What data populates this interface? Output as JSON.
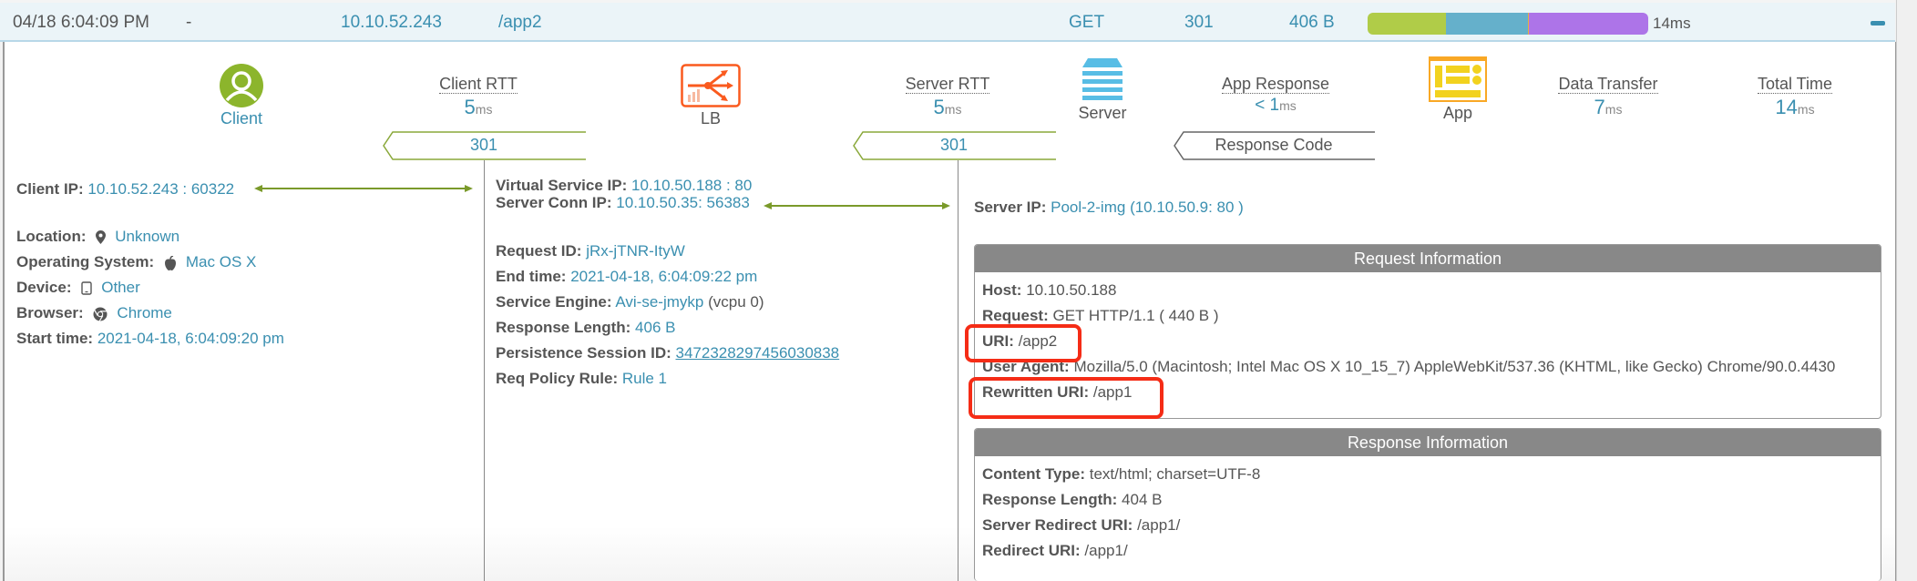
{
  "log_row": {
    "timestamp": "04/18 6:04:09 PM",
    "dash": "-",
    "client_ip": "10.10.52.243",
    "uri": "/app2",
    "method": "GET",
    "status": "301",
    "size": "406 B",
    "total": "14ms",
    "timeline_segments": [
      {
        "name": "client-rtt",
        "fraction": 0.28,
        "color": "#b0cc48"
      },
      {
        "name": "server-rtt",
        "fraction": 0.29,
        "color": "#65b0cb"
      },
      {
        "name": "app-response",
        "fraction": 0.004,
        "color": "#e8b040"
      },
      {
        "name": "data-transfer",
        "fraction": 0.426,
        "color": "#ad74e8"
      }
    ],
    "collapse_icon": "minus-icon"
  },
  "flow": {
    "client": {
      "label": "Client",
      "icon": "user-icon",
      "color": "#8cb52c"
    },
    "client_rtt": {
      "title": "Client RTT",
      "value": "5",
      "unit": "ms"
    },
    "lb": {
      "label": "LB",
      "icon": "load-balancer-icon",
      "color": "#fa5a1e"
    },
    "server_rtt": {
      "title": "Server RTT",
      "value": "5",
      "unit": "ms"
    },
    "server": {
      "label": "Server",
      "icon": "server-icon",
      "color": "#58bde5"
    },
    "app_response": {
      "title": "App Response",
      "value": "< 1",
      "unit": "ms"
    },
    "app": {
      "label": "App",
      "icon": "app-icon",
      "color": "#f2d21e"
    },
    "data_transfer": {
      "title": "Data Transfer",
      "value": "7",
      "unit": "ms"
    },
    "total_time": {
      "title": "Total Time",
      "value": "14",
      "unit": "ms"
    },
    "codes": {
      "client_side": "301",
      "server_side": "301",
      "legend": "Response Code"
    }
  },
  "client": {
    "ip_label": "Client IP:",
    "ip": "10.10.52.243 : 60322",
    "location_label": "Location:",
    "location": "Unknown",
    "os_label": "Operating System:",
    "os": "Mac OS X",
    "device_label": "Device:",
    "device": "Other",
    "browser_label": "Browser:",
    "browser": "Chrome",
    "start_label": "Start time:",
    "start": "2021-04-18, 6:04:09:20 pm"
  },
  "lb": {
    "vs_ip_label": "Virtual Service IP:",
    "vs_ip": "10.10.50.188 : 80",
    "conn_ip_label": "Server Conn IP:",
    "conn_ip": "10.10.50.35: 56383",
    "request_id_label": "Request ID:",
    "request_id": "jRx-jTNR-ItyW",
    "end_label": "End time:",
    "end": "2021-04-18, 6:04:09:22 pm",
    "se_label": "Service Engine:",
    "se": "Avi-se-jmykp",
    "se_extra": "(vcpu 0)",
    "resp_len_label": "Response Length:",
    "resp_len": "406 B",
    "persist_label": "Persistence Session ID:",
    "persist": "3472328297456030838",
    "policy_label": "Req Policy Rule:",
    "policy": "Rule 1"
  },
  "server": {
    "ip_label": "Server IP:",
    "pool": "Pool-2-img",
    "ip": "(10.10.50.9: 80 )"
  },
  "request_info": {
    "title": "Request Information",
    "host_label": "Host:",
    "host": "10.10.50.188",
    "request_label": "Request:",
    "request": "GET HTTP/1.1 ( 440 B )",
    "uri_label": "URI:",
    "uri": "/app2",
    "ua_label": "User Agent:",
    "ua": "Mozilla/5.0 (Macintosh; Intel Mac OS X 10_15_7) AppleWebKit/537.36 (KHTML, like Gecko) Chrome/90.0.4430",
    "rewritten_label": "Rewritten URI:",
    "rewritten": "/app1"
  },
  "response_info": {
    "title": "Response Information",
    "ctype_label": "Content Type:",
    "ctype": "text/html; charset=UTF-8",
    "len_label": "Response Length:",
    "len": "404 B",
    "sredir_label": "Server Redirect URI:",
    "sredir": "/app1/",
    "redir_label": "Redirect URI:",
    "redir": "/app1/"
  },
  "annotations": {
    "highlight_color": "#f52c16"
  }
}
